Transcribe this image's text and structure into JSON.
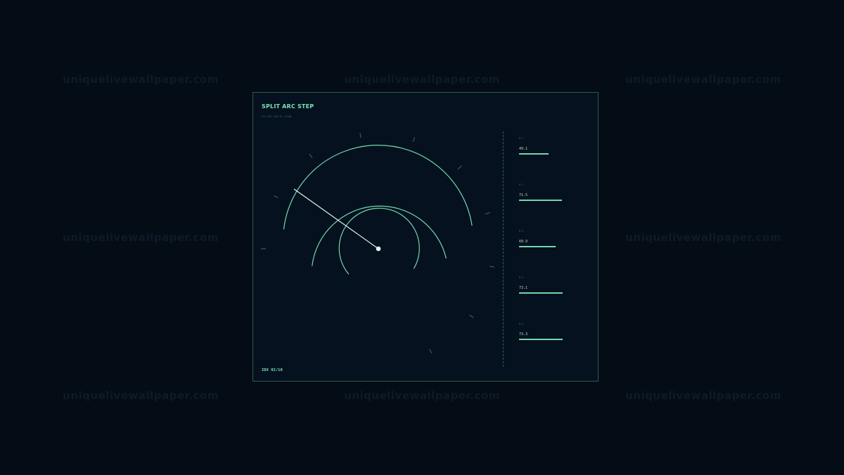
{
  "watermark": "uniquelivewallpaper.com",
  "panel": {
    "title": "SPLIT ARC STEP",
    "subtitle": "SYS ARC.LAB V5 /SCAN",
    "footer_id": "IDX 02/10"
  },
  "gauge": {
    "needle_angle_deg": 150,
    "colors": {
      "arc": "#6fd9ad",
      "needle": "#e8fff4",
      "tick": "#3f6a5c"
    }
  },
  "stats": [
    {
      "label": "M-1",
      "value": "49.1",
      "level": 0.491
    },
    {
      "label": "M-2",
      "value": "71.5",
      "level": 0.715
    },
    {
      "label": "M-3",
      "value": "60.9",
      "level": 0.609
    },
    {
      "label": "M-4",
      "value": "73.1",
      "level": 0.731
    },
    {
      "label": "M-5",
      "value": "73.3",
      "level": 0.733
    }
  ],
  "colors": {
    "background": "#040c16",
    "panel": "#06111f",
    "border": "#2a5e49",
    "accent": "#7ee0b6"
  }
}
